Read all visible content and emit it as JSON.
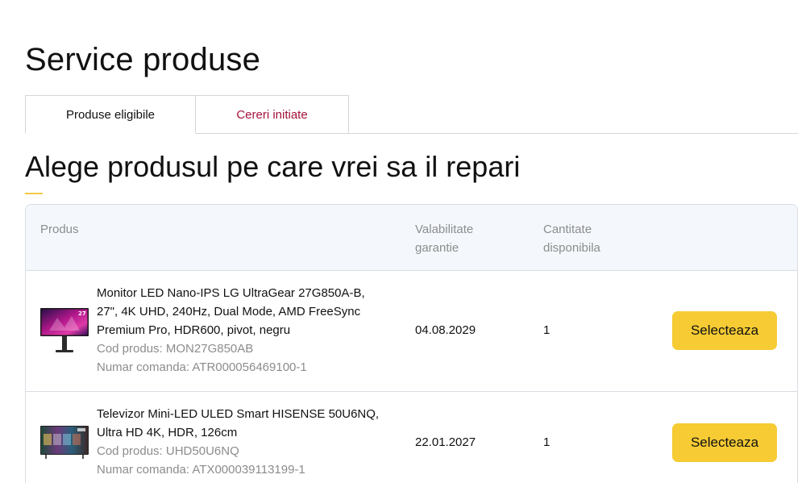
{
  "page": {
    "title": "Service produse"
  },
  "tabs": [
    {
      "label": "Produse eligibile",
      "active": true
    },
    {
      "label": "Cereri initiate",
      "active": false
    }
  ],
  "section": {
    "title": "Alege produsul pe care vrei sa il repari"
  },
  "table": {
    "headers": {
      "product": "Produs",
      "warranty": "Valabilitate garantie",
      "quantity": "Cantitate disponibila"
    },
    "rows": [
      {
        "image_icon": "monitor-product-image",
        "name": "Monitor LED Nano-IPS LG UltraGear 27G850A-B, 27\", 4K UHD, 240Hz, Dual Mode, AMD FreeSync Premium Pro, HDR600, pivot, negru",
        "product_code": "Cod produs: MON27G850AB",
        "order_number": "Numar comanda: ATR000056469100-1",
        "warranty": "04.08.2029",
        "quantity": "1",
        "action_label": "Selecteaza"
      },
      {
        "image_icon": "tv-product-image",
        "name": "Televizor Mini-LED ULED Smart HISENSE 50U6NQ, Ultra HD 4K, HDR, 126cm",
        "product_code": "Cod produs: UHD50U6NQ",
        "order_number": "Numar comanda: ATX000039113199-1",
        "warranty": "22.01.2027",
        "quantity": "1",
        "action_label": "Selecteaza"
      }
    ]
  },
  "colors": {
    "accent_yellow": "#f6cb34",
    "inactive_tab_text": "#a3123a",
    "header_background": "#f4f8fc",
    "muted_text": "#8c8c8c"
  }
}
